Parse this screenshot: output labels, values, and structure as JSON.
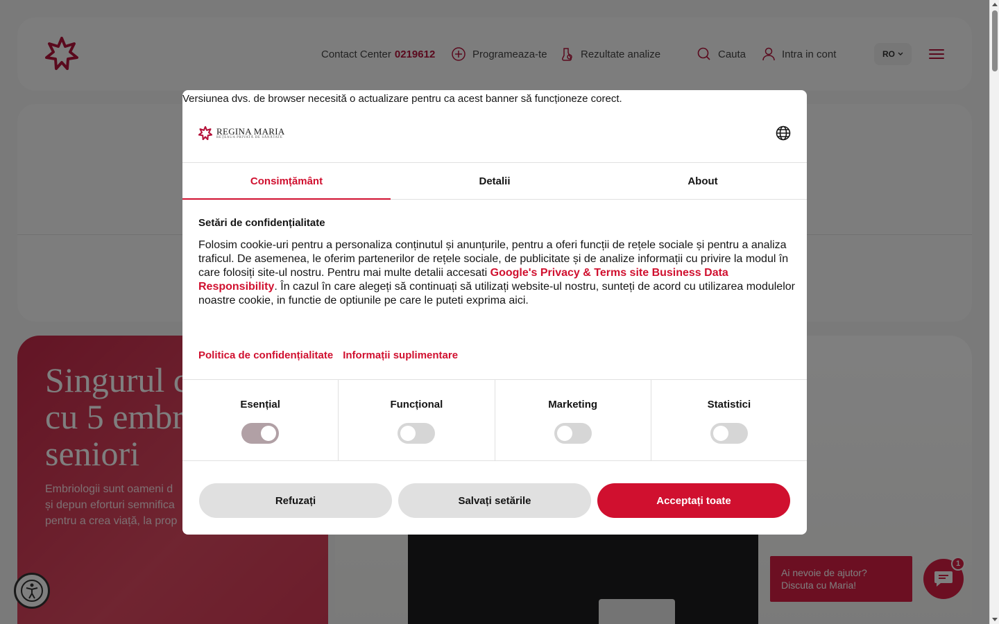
{
  "header": {
    "contact_label": "Contact Center",
    "contact_phone": "0219612",
    "schedule": "Programeaza-te",
    "results": "Rezultate analize",
    "search": "Cauta",
    "account": "Intra in cont",
    "language": "RO"
  },
  "hero": {
    "title": "Singurul c\ncu 5 embr\nseniori",
    "text": "Embriologii sunt oameni d\nși depun eforturi semnifica\npentru a crea viață, la prop"
  },
  "chat": {
    "bubble": "Ai nevoie de ajutor?\nDiscuta cu Maria!",
    "badge": "1"
  },
  "cookie": {
    "browser_warning": "Versiunea dvs. de browser necesită o actualizare pentru ca acest banner să funcționeze corect.",
    "brand_name": "REGINA MARIA",
    "brand_sub": "REȚEAUA PRIVATĂ DE SĂNĂTATE",
    "tabs": [
      "Consimțământ",
      "Detalii",
      "About"
    ],
    "section_title": "Setări de confidențialitate",
    "text_1": "Folosim cookie-uri pentru a personaliza conținutul și anunțurile, pentru a oferi funcții de rețele sociale și pentru a analiza traficul. De asemenea, le oferim partenerilor de rețele sociale, de publicitate și de analize informații cu privire la modul în care folosiți site-ul nostru. Pentru mai multe detalii accesati ",
    "link_text": "Google's Privacy & Terms site Business Data Responsibility",
    "text_2": ". În cazul în care alegeți să continuați să utilizați website-ul nostru, sunteți de acord cu utilizarea modulelor noastre cookie, in functie de optiunile pe care le puteti exprima aici.",
    "link_privacy": "Politica de confidențialitate",
    "link_more": "Informații suplimentare",
    "categories": [
      {
        "label": "Esențial",
        "enabled": true
      },
      {
        "label": "Funcțional",
        "enabled": false
      },
      {
        "label": "Marketing",
        "enabled": false
      },
      {
        "label": "Statistici",
        "enabled": false
      }
    ],
    "btn_refuse": "Refuzați",
    "btn_save": "Salvați setările",
    "btn_accept": "Acceptați toate",
    "accent_color": "#d0102f"
  }
}
